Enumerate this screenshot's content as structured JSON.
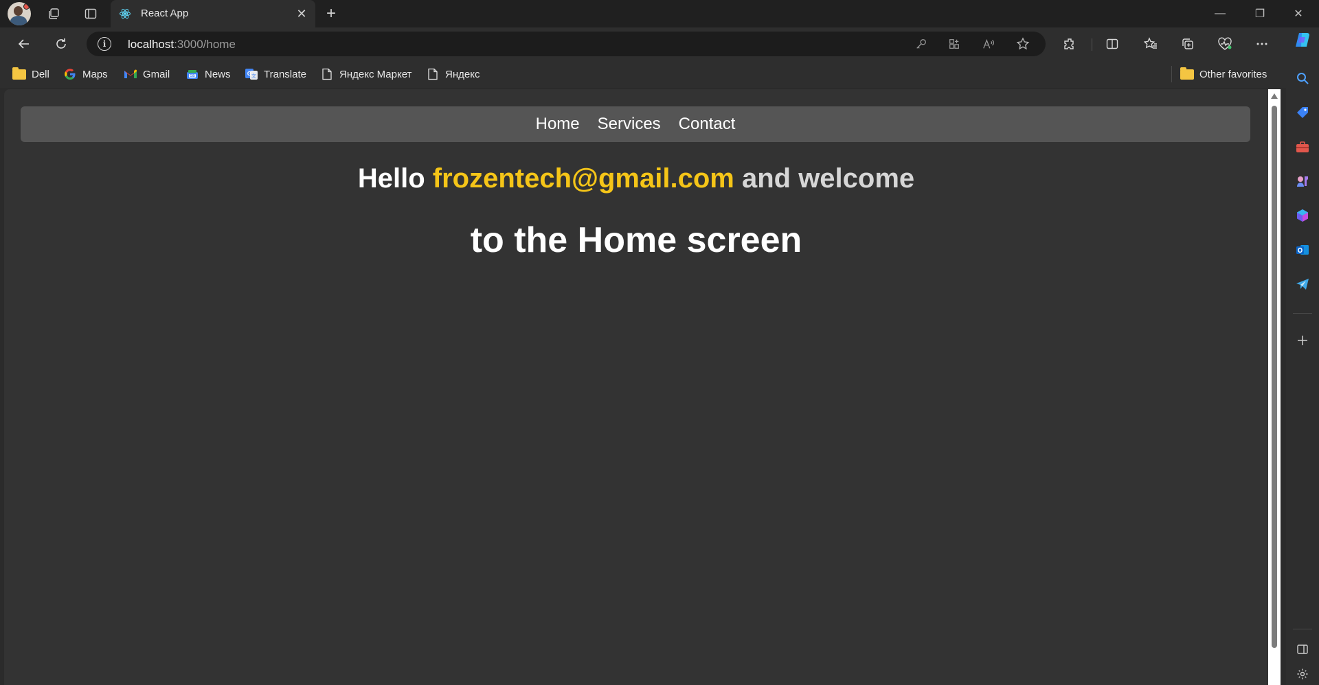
{
  "browser": {
    "tab": {
      "title": "React App",
      "close_glyph": "✕"
    },
    "new_tab_glyph": "+",
    "window_controls": {
      "minimize": "—",
      "restore": "❐",
      "close": "✕"
    },
    "address": {
      "host": "localhost",
      "path": ":3000/home"
    },
    "favorites": [
      {
        "label": "Dell",
        "icon": "folder-icon"
      },
      {
        "label": "Maps",
        "icon": "google-icon"
      },
      {
        "label": "Gmail",
        "icon": "gmail-icon"
      },
      {
        "label": "News",
        "icon": "news-icon"
      },
      {
        "label": "Translate",
        "icon": "translate-icon"
      },
      {
        "label": "Яндекс Маркет",
        "icon": "page-icon"
      },
      {
        "label": "Яндекс",
        "icon": "page-icon"
      }
    ],
    "other_favorites": "Other favorites",
    "colors": {
      "accent_yellow": "#f5c518",
      "folder": "#f4c542",
      "page_bg": "#333333",
      "nav_bg": "#555555"
    }
  },
  "page": {
    "nav": {
      "home": "Home",
      "services": "Services",
      "contact": "Contact"
    },
    "greeting": {
      "hello": "Hello",
      "email": "frozentech@gmail.com",
      "welcome": "and welcome",
      "line2": "to the Home screen"
    }
  }
}
